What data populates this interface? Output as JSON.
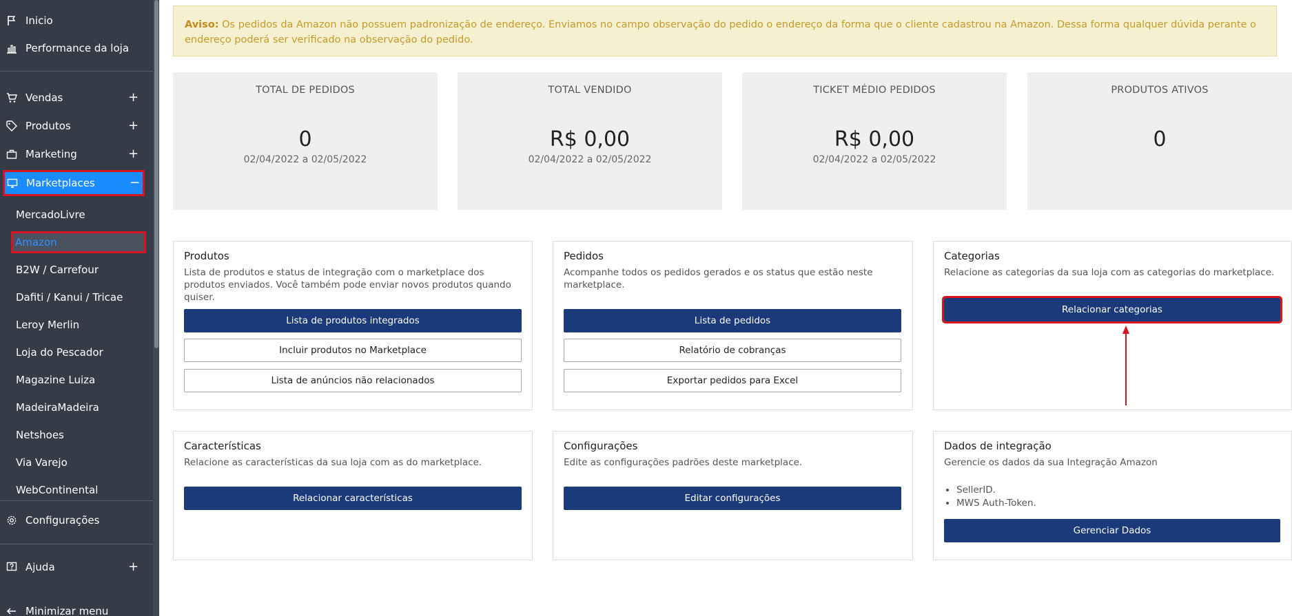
{
  "sidebar": {
    "top_items": [
      {
        "label": "Inicio",
        "icon": "flag-icon"
      },
      {
        "label": "Performance da loja",
        "icon": "bar-chart-icon"
      }
    ],
    "sections": [
      {
        "label": "Vendas",
        "icon": "cart-icon",
        "toggle": "+"
      },
      {
        "label": "Produtos",
        "icon": "tag-icon",
        "toggle": "+"
      },
      {
        "label": "Marketing",
        "icon": "briefcase-icon",
        "toggle": "+"
      },
      {
        "label": "Marketplaces",
        "icon": "monitor-icon",
        "toggle": "−"
      }
    ],
    "marketplaces": [
      "MercadoLivre",
      "Amazon",
      "B2W / Carrefour",
      "Dafiti / Kanui / Tricae",
      "Leroy Merlin",
      "Loja do Pescador",
      "Magazine Luiza",
      "MadeiraMadeira",
      "Netshoes",
      "Via Varejo",
      "WebContinental"
    ],
    "configuracoes": {
      "label": "Configurações",
      "icon": "gear-icon"
    },
    "ajuda": {
      "label": "Ajuda",
      "icon": "help-icon",
      "toggle": "+"
    },
    "minimizar": {
      "label": "Minimizar menu",
      "icon": "arrow-left-icon"
    },
    "colors": {
      "bg": "#353c48",
      "active": "#1a8cff",
      "selected_text": "#2f8fff",
      "highlight": "#d9141e"
    }
  },
  "notice": {
    "prefix": "Aviso:",
    "text": " Os pedidos da Amazon não possuem padronização de endereço. Enviamos no campo observação do pedido o endereço da forma que o cliente cadastrou na Amazon. Dessa forma qualquer dúvida perante o endereço poderá ser verificado na observação do pedido."
  },
  "stats": [
    {
      "title": "TOTAL DE PEDIDOS",
      "value": "0",
      "range": "02/04/2022 a 02/05/2022"
    },
    {
      "title": "TOTAL VENDIDO",
      "value": "R$ 0,00",
      "range": "02/04/2022 a 02/05/2022"
    },
    {
      "title": "TICKET MÉDIO PEDIDOS",
      "value": "R$ 0,00",
      "range": "02/04/2022 a 02/05/2022"
    },
    {
      "title": "PRODUTOS ATIVOS",
      "value": "0",
      "range": ""
    }
  ],
  "cards": {
    "produtos": {
      "title": "Produtos",
      "desc": "Lista de produtos e status de integração com o marketplace dos produtos enviados. Você também pode enviar novos produtos quando quiser.",
      "buttons": [
        "Lista de produtos integrados",
        "Incluir produtos no Marketplace",
        "Lista de anúncios não relacionados"
      ]
    },
    "pedidos": {
      "title": "Pedidos",
      "desc": "Acompanhe todos os pedidos gerados e os status que estão neste marketplace.",
      "buttons": [
        "Lista de pedidos",
        "Relatório de cobranças",
        "Exportar pedidos para Excel"
      ]
    },
    "categorias": {
      "title": "Categorias",
      "desc": "Relacione as categorias da sua loja com as categorias do marketplace.",
      "button": "Relacionar categorias"
    },
    "caracteristicas": {
      "title": "Características",
      "desc": "Relacione as características da sua loja com as do marketplace.",
      "button": "Relacionar características"
    },
    "configuracoes": {
      "title": "Configurações",
      "desc": "Edite as configurações padrões deste marketplace.",
      "button": "Editar configurações"
    },
    "integracao": {
      "title": "Dados de integração",
      "desc": "Gerencie os dados da sua Integração Amazon",
      "items": [
        "SellerID.",
        "MWS Auth-Token."
      ],
      "button": "Gerenciar Dados"
    }
  }
}
